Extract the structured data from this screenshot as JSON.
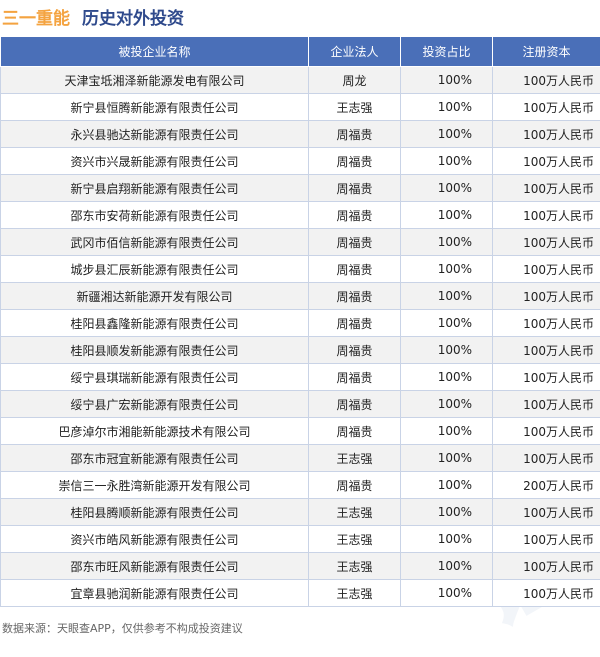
{
  "header": {
    "company": "三一重能",
    "title": "历史对外投资"
  },
  "table": {
    "columns": [
      "被投企业名称",
      "企业法人",
      "投资占比",
      "注册资本"
    ],
    "rows": [
      [
        "天津宝坻湘泽新能源发电有限公司",
        "周龙",
        "100%",
        "100万人民币"
      ],
      [
        "新宁县恒腾新能源有限责任公司",
        "王志强",
        "100%",
        "100万人民币"
      ],
      [
        "永兴县驰达新能源有限责任公司",
        "周福贵",
        "100%",
        "100万人民币"
      ],
      [
        "资兴市兴晟新能源有限责任公司",
        "周福贵",
        "100%",
        "100万人民币"
      ],
      [
        "新宁县启翔新能源有限责任公司",
        "周福贵",
        "100%",
        "100万人民币"
      ],
      [
        "邵东市安荷新能源有限责任公司",
        "周福贵",
        "100%",
        "100万人民币"
      ],
      [
        "武冈市佰信新能源有限责任公司",
        "周福贵",
        "100%",
        "100万人民币"
      ],
      [
        "城步县汇辰新能源有限责任公司",
        "周福贵",
        "100%",
        "100万人民币"
      ],
      [
        "新疆湘达新能源开发有限公司",
        "周福贵",
        "100%",
        "100万人民币"
      ],
      [
        "桂阳县鑫隆新能源有限责任公司",
        "周福贵",
        "100%",
        "100万人民币"
      ],
      [
        "桂阳县顺发新能源有限责任公司",
        "周福贵",
        "100%",
        "100万人民币"
      ],
      [
        "绥宁县琪瑞新能源有限责任公司",
        "周福贵",
        "100%",
        "100万人民币"
      ],
      [
        "绥宁县广宏新能源有限责任公司",
        "周福贵",
        "100%",
        "100万人民币"
      ],
      [
        "巴彦淖尔市湘能新能源技术有限公司",
        "周福贵",
        "100%",
        "100万人民币"
      ],
      [
        "邵东市冠宜新能源有限责任公司",
        "王志强",
        "100%",
        "100万人民币"
      ],
      [
        "崇信三一永胜湾新能源开发有限公司",
        "周福贵",
        "100%",
        "200万人民币"
      ],
      [
        "桂阳县腾顺新能源有限责任公司",
        "王志强",
        "100%",
        "100万人民币"
      ],
      [
        "资兴市皓风新能源有限责任公司",
        "王志强",
        "100%",
        "100万人民币"
      ],
      [
        "邵东市旺风新能源有限责任公司",
        "王志强",
        "100%",
        "100万人民币"
      ],
      [
        "宜章县驰润新能源有限责任公司",
        "王志强",
        "100%",
        "100万人民币"
      ]
    ]
  },
  "footer": "数据来源：天眼查APP，仅供参考不构成投资建议",
  "colors": {
    "company": "#f4a340",
    "title": "#2f4a8c",
    "header_bg": "#4a6fb8",
    "stripe": "#f2f2f2"
  }
}
